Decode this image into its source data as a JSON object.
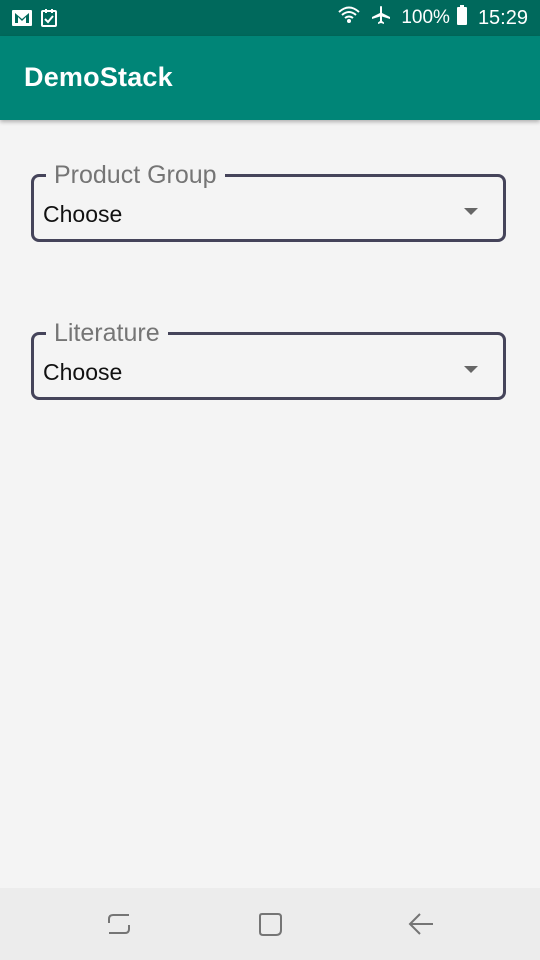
{
  "status_bar": {
    "left_icons": [
      "gmail-icon",
      "checkbox-notification-icon"
    ],
    "right_icons": [
      "wifi-icon",
      "airplane-mode-icon",
      "battery-icon"
    ],
    "battery_text": "100%",
    "time": "15:29"
  },
  "app_bar": {
    "title": "DemoStack",
    "color": "#008577"
  },
  "form": {
    "product_group": {
      "label": "Product Group",
      "value": "Choose"
    },
    "literature": {
      "label": "Literature",
      "value": "Choose"
    }
  },
  "nav_bar": {
    "buttons": [
      "recent-apps-icon",
      "home-icon",
      "back-icon"
    ]
  }
}
